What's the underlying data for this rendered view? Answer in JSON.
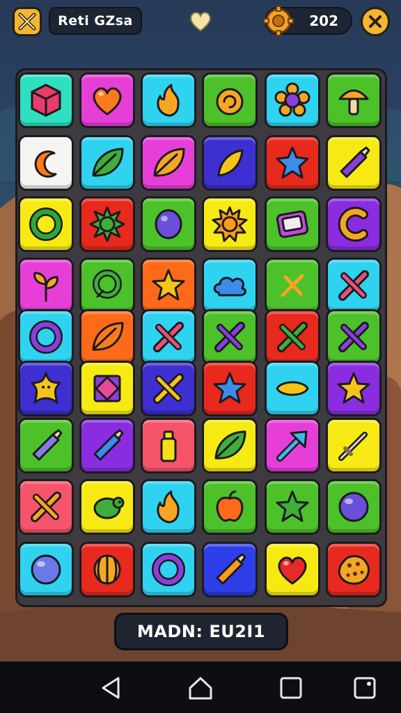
{
  "header": {
    "title": "Reti GZsa",
    "coin_count": "202",
    "left_icon": "crossed-tools-icon",
    "center_icon": "heart-icon",
    "coin_icon": "gear-coin-icon",
    "close_icon": "close-icon"
  },
  "footer": {
    "status_text": "MADN: EU2I1"
  },
  "navbar": [
    "back-icon",
    "home-icon",
    "recents-icon",
    "screenshot-icon"
  ],
  "colors": {
    "teal": "#2ee0c0",
    "magenta": "#e63fd8",
    "cyan": "#2fd3ef",
    "green": "#4dc12a",
    "white": "#f4f4f2",
    "indigo": "#3d2fd0",
    "red": "#e8291d",
    "yellow": "#f7ea14",
    "purple": "#8a2de0",
    "orange": "#ff6a1a",
    "coral": "#f5546a",
    "blue": "#2e3ee8",
    "gold": "#f2b632"
  },
  "board": {
    "rows": [
      [
        {
          "bg": "teal",
          "icon": "cube"
        },
        {
          "bg": "magenta",
          "icon": "heart"
        },
        {
          "bg": "cyan",
          "icon": "flame"
        },
        {
          "bg": "green",
          "icon": "swirl"
        },
        {
          "bg": "cyan",
          "icon": "flower"
        },
        {
          "bg": "green",
          "icon": "mushroom"
        }
      ],
      [
        {
          "bg": "white",
          "icon": "crescent"
        },
        {
          "bg": "cyan",
          "icon": "leaf"
        },
        {
          "bg": "magenta",
          "icon": "leaf"
        },
        {
          "bg": "indigo",
          "icon": "flame-leaf"
        },
        {
          "bg": "red",
          "icon": "star-blob"
        },
        {
          "bg": "yellow",
          "icon": "crayon"
        }
      ],
      [
        {
          "bg": "yellow",
          "icon": "ring"
        },
        {
          "bg": "red",
          "icon": "spiky-ball"
        },
        {
          "bg": "green",
          "icon": "gem"
        },
        {
          "bg": "yellow",
          "icon": "sun"
        },
        {
          "bg": "green",
          "icon": "screen"
        },
        {
          "bg": "purple",
          "icon": "letter-c"
        }
      ],
      [
        {
          "bg": "magenta",
          "icon": "sprout"
        },
        {
          "bg": "green",
          "icon": "ring-leaf"
        },
        {
          "bg": "orange",
          "icon": "star"
        },
        {
          "bg": "cyan",
          "icon": "cloud"
        },
        {
          "bg": "green",
          "icon": "cross-pin"
        },
        {
          "bg": "cyan",
          "icon": "cross"
        }
      ],
      [
        {
          "bg": "cyan",
          "icon": "ring"
        },
        {
          "bg": "orange",
          "icon": "leaf"
        },
        {
          "bg": "cyan",
          "icon": "cross"
        },
        {
          "bg": "green",
          "icon": "cross"
        },
        {
          "bg": "red",
          "icon": "cross"
        },
        {
          "bg": "green",
          "icon": "cross"
        }
      ],
      [
        {
          "bg": "indigo",
          "icon": "starfish"
        },
        {
          "bg": "yellow",
          "icon": "diamond-box"
        },
        {
          "bg": "indigo",
          "icon": "cross"
        },
        {
          "bg": "red",
          "icon": "star"
        },
        {
          "bg": "cyan",
          "icon": "lemon"
        },
        {
          "bg": "purple",
          "icon": "star"
        }
      ],
      [
        {
          "bg": "green",
          "icon": "crayon"
        },
        {
          "bg": "purple",
          "icon": "crayon"
        },
        {
          "bg": "coral",
          "icon": "bottle"
        },
        {
          "bg": "yellow",
          "icon": "leaf"
        },
        {
          "bg": "magenta",
          "icon": "arrow"
        },
        {
          "bg": "yellow",
          "icon": "sword"
        }
      ],
      [
        {
          "bg": "coral",
          "icon": "cross"
        },
        {
          "bg": "yellow",
          "icon": "turtle"
        },
        {
          "bg": "cyan",
          "icon": "flame"
        },
        {
          "bg": "green",
          "icon": "apple"
        },
        {
          "bg": "green",
          "icon": "star"
        },
        {
          "bg": "green",
          "icon": "orb"
        }
      ],
      [
        {
          "bg": "cyan",
          "icon": "orb"
        },
        {
          "bg": "red",
          "icon": "melon"
        },
        {
          "bg": "cyan",
          "icon": "ring"
        },
        {
          "bg": "blue",
          "icon": "crayon"
        },
        {
          "bg": "yellow",
          "icon": "heart"
        },
        {
          "bg": "red",
          "icon": "cookie"
        }
      ]
    ],
    "icon_colors": [
      [
        "#e83c6a",
        "#ff7a1a",
        "#f5a623",
        "#f5a623",
        "#8a3fd8",
        "#f5a623"
      ],
      [
        "#ff7a1a",
        "#3fae3a",
        "#f5a623",
        "#f5c418",
        "#3b8de8",
        "#8a3fd8"
      ],
      [
        "#2ea63a",
        "#3fae3a",
        "#6a4fd8",
        "#ff9a1a",
        "#c04ad8",
        "#f5a623"
      ],
      [
        "#f5a623",
        "#3fae3a",
        "#f5c418",
        "#3b8de8",
        "#f5a623",
        "#e8507a"
      ],
      [
        "#8a3fd8",
        "#ff7a1a",
        "#e8507a",
        "#8a3fd8",
        "#3fae3a",
        "#8a3fd8"
      ],
      [
        "#f5c418",
        "#8a3fd8",
        "#f5c418",
        "#3b8de8",
        "#f5c418",
        "#f5c418"
      ],
      [
        "#8a7ae8",
        "#3b8de8",
        "#f5e018",
        "#3fae3a",
        "#3bb8e8",
        "#8a6a4a"
      ],
      [
        "#f5a623",
        "#3fae3a",
        "#f5a623",
        "#ff6a1a",
        "#3fae3a",
        "#6a4fd8"
      ],
      [
        "#6a7ae8",
        "#f5a623",
        "#8a3fd8",
        "#ff9a1a",
        "#e8292a",
        "#f5a623"
      ]
    ]
  }
}
